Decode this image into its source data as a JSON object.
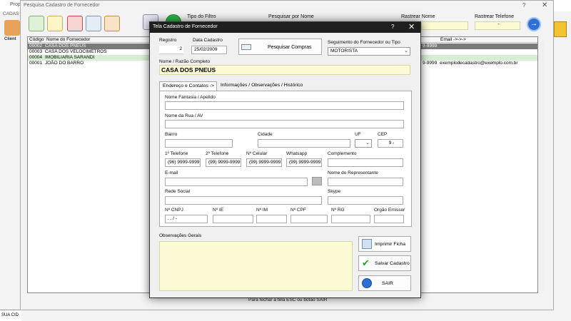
{
  "bg": {
    "app_title": "Prop",
    "menu": "CADAS",
    "client_label": "Client",
    "sidebar_bottom": "SUA CID",
    "search_window_title": "Pesquisa Cadastro de Fornecedor",
    "help_glyph": "?",
    "close_glyph": "✕",
    "filter_type_label": "Tipo do Filtro",
    "search_by_name_label": "Pesquisar por Nome",
    "track_name_label": "Rastrear Nome",
    "track_phone_label": "Rastrear Telefone",
    "track_phone_value": "-",
    "go_glyph": "→",
    "grid_headers": [
      "Código",
      "Nome do Fornecedor",
      "Email ->->->"
    ],
    "grid_rows": [
      {
        "code": "00002",
        "name": "CASA DOS PNEUS",
        "phone": "9-9999",
        "email": ""
      },
      {
        "code": "00003",
        "name": "CASA DOS VELOCIMETROS",
        "phone": "",
        "email": ""
      },
      {
        "code": "00004",
        "name": "IMOBILIARIA SARANDI",
        "phone": "",
        "email": ""
      },
      {
        "code": "00001",
        "name": "JOÃO DO BARRO",
        "phone": "9-9999",
        "email": "exemplodecadastro@exemplo.com.br"
      }
    ],
    "footer_note": "Para fechar a tela ESC ou botão SAIR"
  },
  "modal": {
    "title": "Tela Cadastro de Fornecedor",
    "help_glyph": "?",
    "close_glyph": "✕",
    "registro_label": "Registro",
    "registro_value": "2",
    "data_label": "Data Cadastro",
    "data_value": "25/02/2009",
    "pesquisar_compras": "Pesquisar Compras",
    "segmento_label": "Seguimento do Fornecedor ou Tipo",
    "segmento_value": "MOTORISTA",
    "razao_label": "Nome / Razão Completo",
    "razao_value": "CASA DOS PNEUS",
    "tabs": [
      "Endereço e Contatos ->",
      "Informações / Observações / Histórico"
    ],
    "fields": {
      "fantasia": "Nome Fantasia / Apelido",
      "rua": "Nome da Rua / AV",
      "bairro": "Bairro",
      "cidade": "Cidade",
      "uf": "UF",
      "cep": "CEP",
      "cep_value": "9   -",
      "tel1": "1º Telefone",
      "tel1_value": "(96) 9999-9999",
      "tel2": "2º Telefone",
      "tel2_value": "(99) 9999-9999",
      "celular": "Nº Celular",
      "celular_value": "(99) 9999-9999",
      "whatsapp": "Whatsapp",
      "whatsapp_value": "(99) 9999-9999",
      "complemento": "Complemento",
      "email": "E-mail",
      "representante": "Nome do Representante",
      "rede_social": "Rede Social",
      "skype": "Skype",
      "cnpj": "Nº CNPJ",
      "cnpj_value": "  .    .    /    -",
      "ie": "Nº IE",
      "im": "Nº IM",
      "cpf": "Nº CPF",
      "rg": "Nº RG",
      "orgao": "Orgão Emissor"
    },
    "obs_label": "Observações Gerais",
    "btn_imprimir": "Imprimir Ficha",
    "btn_salvar": "Salvar Cadastro",
    "btn_sair": "SAIR"
  }
}
